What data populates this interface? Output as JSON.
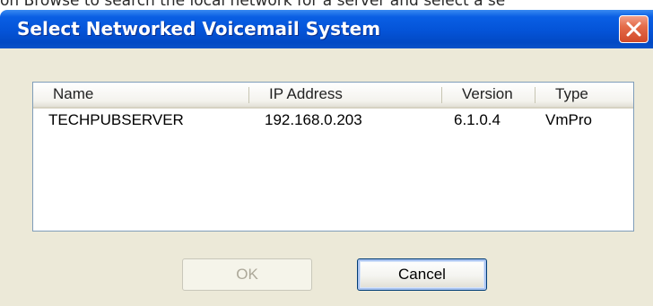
{
  "background_text": "on Browse to search the local network for a server and select a se",
  "dialog": {
    "title": "Select Networked Voicemail System",
    "close_icon": "close-x-icon",
    "colors": {
      "titlebar": "#0453d7",
      "client": "#ece9d8",
      "close_button": "#e46c4a"
    }
  },
  "list": {
    "columns": [
      "Name",
      "IP Address",
      "Version",
      "Type"
    ],
    "rows": [
      {
        "name": "TECHPUBSERVER",
        "ip": "192.168.0.203",
        "version": "6.1.0.4",
        "type": "VmPro"
      }
    ]
  },
  "buttons": {
    "ok_label": "OK",
    "ok_enabled": false,
    "cancel_label": "Cancel"
  }
}
